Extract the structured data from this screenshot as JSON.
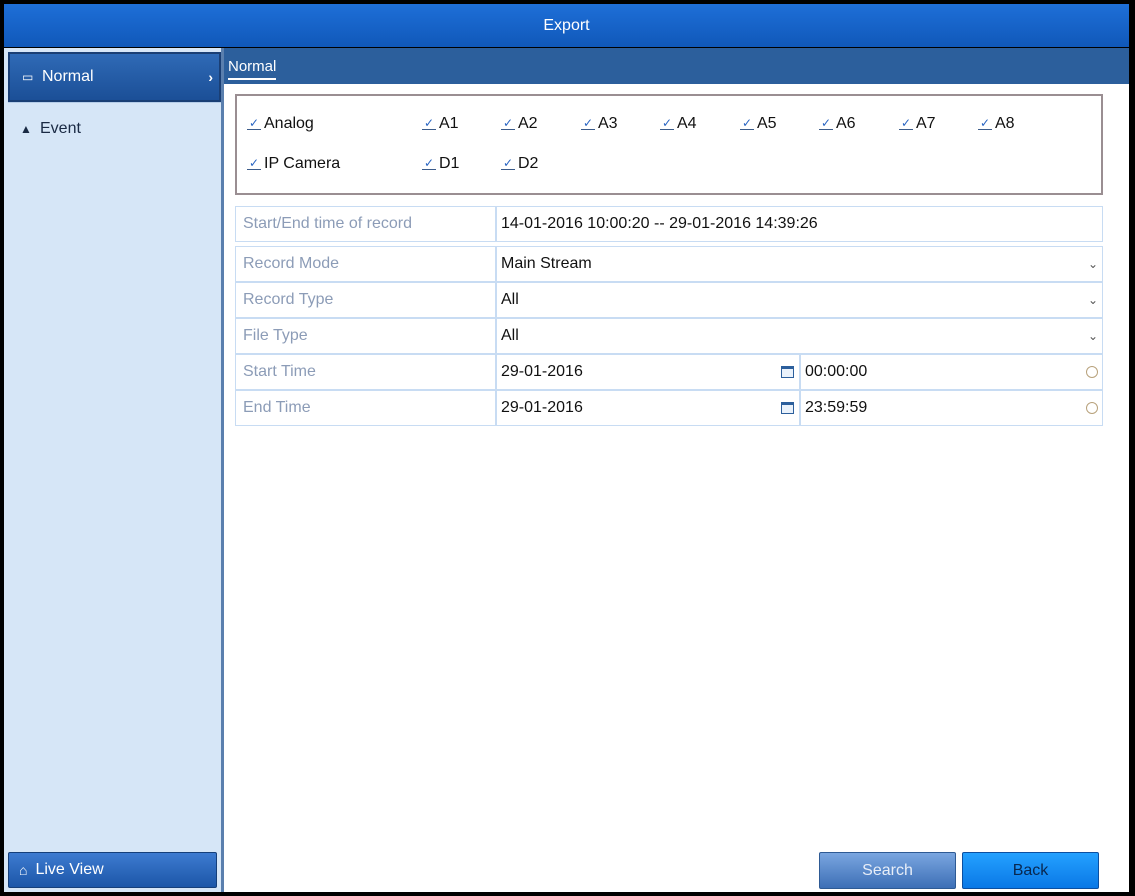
{
  "window": {
    "title": "Export"
  },
  "sidebar": {
    "items": [
      {
        "label": "Normal",
        "icon": "folder-icon",
        "active": true
      },
      {
        "label": "Event",
        "icon": "pin-icon",
        "active": false
      }
    ],
    "live_view_label": "Live View"
  },
  "tab": {
    "label": "Normal"
  },
  "cameras": {
    "analog_label": "Analog",
    "analog_channels": [
      "A1",
      "A2",
      "A3",
      "A4",
      "A5",
      "A6",
      "A7",
      "A8"
    ],
    "ip_label": "IP Camera",
    "ip_channels": [
      "D1",
      "D2"
    ]
  },
  "form": {
    "record_range": {
      "label": "Start/End time of record",
      "value": "14-01-2016 10:00:20 -- 29-01-2016 14:39:26"
    },
    "record_mode": {
      "label": "Record Mode",
      "value": "Main Stream"
    },
    "record_type": {
      "label": "Record Type",
      "value": "All"
    },
    "file_type": {
      "label": "File Type",
      "value": "All"
    },
    "start_time": {
      "label": "Start Time",
      "date": "29-01-2016",
      "time": "00:00:00"
    },
    "end_time": {
      "label": "End Time",
      "date": "29-01-2016",
      "time": "23:59:59"
    }
  },
  "buttons": {
    "search": "Search",
    "back": "Back"
  },
  "colors": {
    "accent": "#1e6fd8",
    "back_button": "#0a78e6",
    "sidebar_bg": "#d6e6f7"
  }
}
